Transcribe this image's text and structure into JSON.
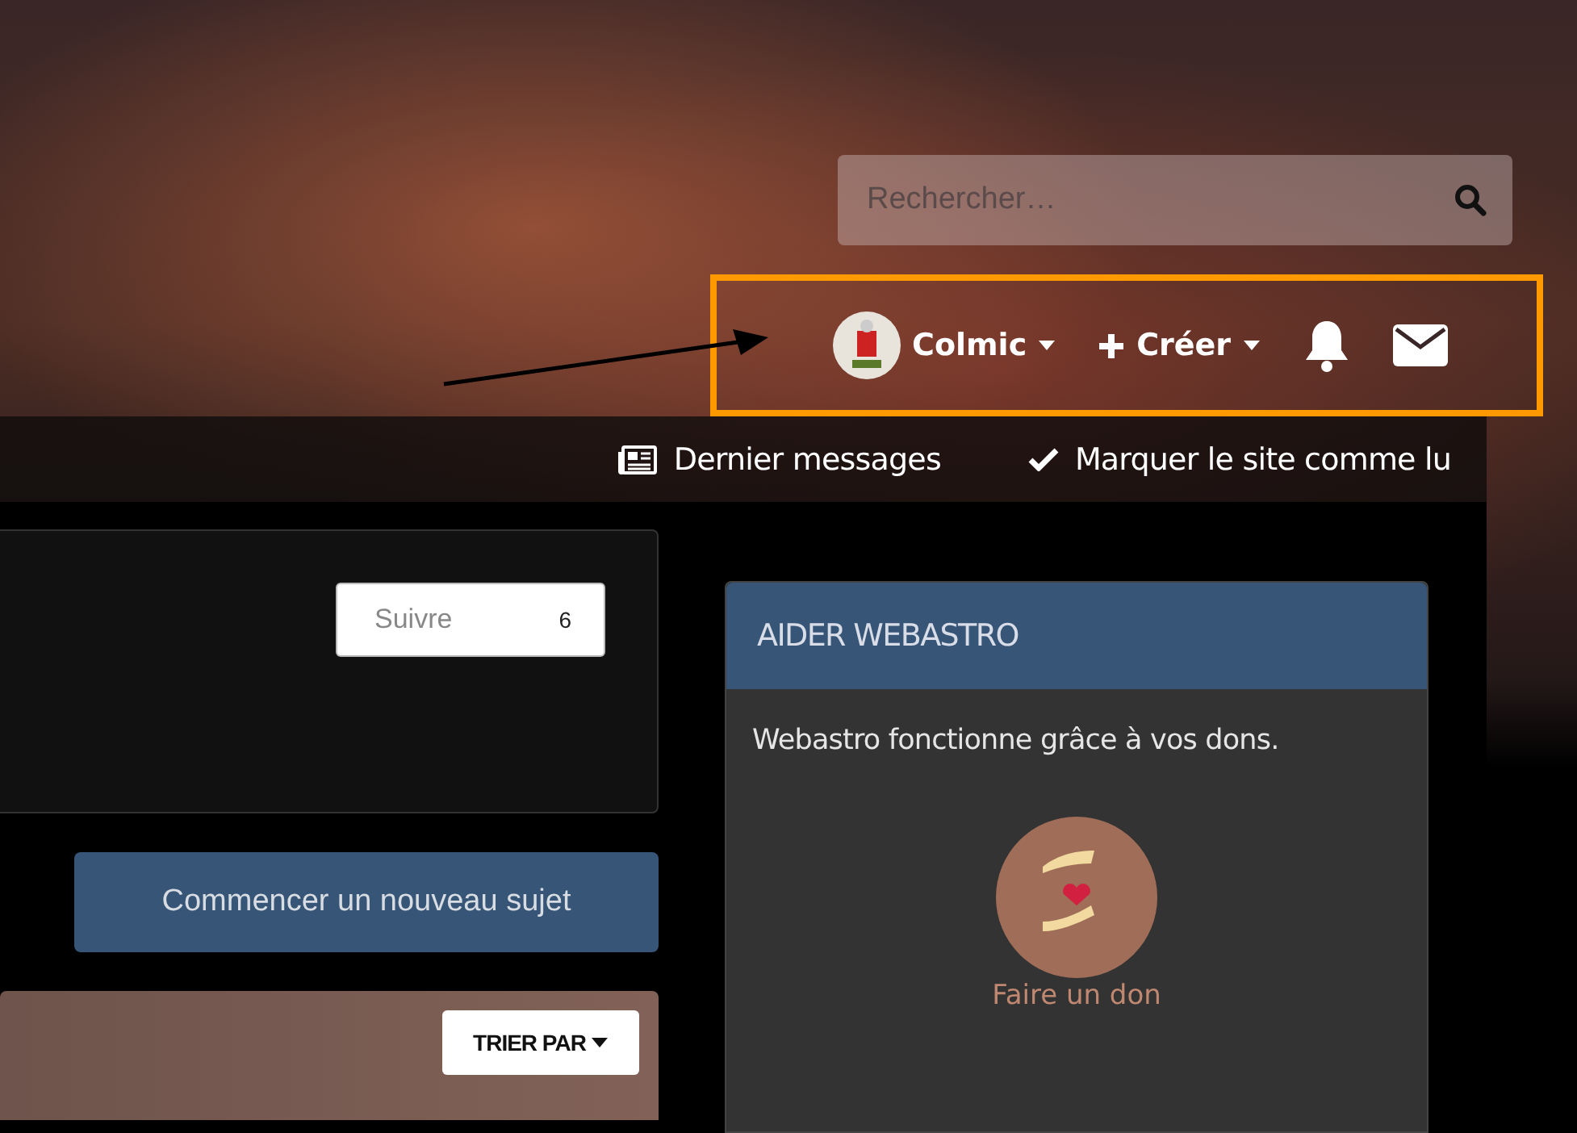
{
  "search": {
    "placeholder": "Rechercher…"
  },
  "user_menu": {
    "username": "Colmic",
    "create_label": "Créer"
  },
  "nav": [
    {
      "kind": "news",
      "label": "Dernier messages"
    },
    {
      "kind": "check",
      "label": "Marquer le site comme lu"
    }
  ],
  "forum_card": {
    "follow_label": "Suivre",
    "follow_count": "6"
  },
  "new_topic_button": "Commencer un nouveau sujet",
  "sort_button": "TRIER PAR",
  "widget": {
    "title": "AIDER WEBASTRO",
    "text": "Webastro fonctionne grâce à vos dons.",
    "donate_label": "Faire un don"
  }
}
